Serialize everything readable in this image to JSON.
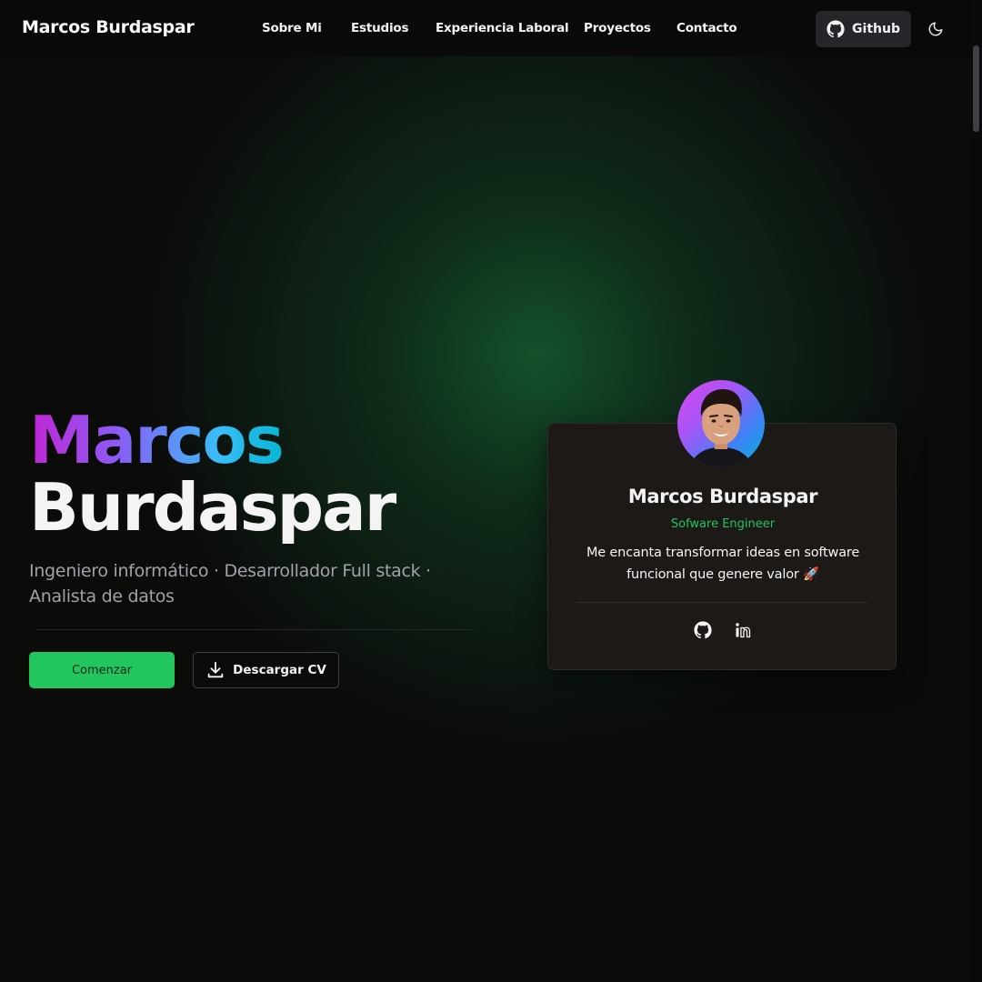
{
  "nav": {
    "brand": "Marcos Burdaspar",
    "links": [
      {
        "label": "Sobre Mi"
      },
      {
        "label": "Estudios"
      },
      {
        "label": "Experiencia Laboral"
      },
      {
        "label": "Proyectos"
      },
      {
        "label": "Contacto"
      }
    ],
    "github_label": "Github",
    "github_icon": "github-icon",
    "theme_icon": "moon-icon"
  },
  "hero": {
    "first_name": "Marcos",
    "last_name": "Burdaspar",
    "subtitle": "Ingeniero informático · Desarrollador Full stack · Analista de datos",
    "primary_button": "Comenzar",
    "download_button": "Descargar CV",
    "download_icon": "download-icon"
  },
  "card": {
    "name": "Marcos Burdaspar",
    "role": "Sofware Engineer",
    "bio": "Me encanta transformar ideas en software funcional que genere valor 🚀",
    "social": [
      {
        "icon": "github-icon"
      },
      {
        "icon": "linkedin-icon"
      }
    ]
  },
  "colors": {
    "accent": "#22c55e",
    "background": "#0b0b0a",
    "card": "#1c1917",
    "glow": "#166534",
    "gradient": [
      "#c026d3",
      "#8b5cf6",
      "#38bdf8",
      "#06b6d4"
    ]
  }
}
